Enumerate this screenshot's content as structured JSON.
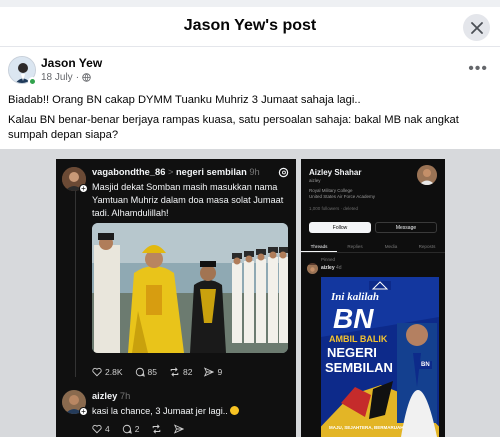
{
  "dialog": {
    "title": "Jason Yew's post"
  },
  "post": {
    "author": "Jason Yew",
    "date": "18 July",
    "dot": "·",
    "more": "•••",
    "paragraphs": [
      "Biadab!! Orang BN cakap DYMM Tuanku Muhriz 3 Jumaat sahaja lagi..",
      "Kalau BN benar-benar berjaya rampas kuasa, satu persoalan sahaja: bakal MB nak angkat sumpah depan siapa?"
    ]
  },
  "threads_post": {
    "username": "vagabondthe_86",
    "separator": ">",
    "community": "negeri sembilan",
    "time": "9h",
    "text": "Masjid dekat Somban masih masukkan nama Yamtuan Muhriz dalam doa masa solat Jumaat tadi. Alhamdulillah!",
    "likes": "2.8K",
    "replies": "85",
    "reposts": "82",
    "shares": "9"
  },
  "threads_reply": {
    "username": "aizley",
    "time": "7h",
    "text": "kasi la chance, 3 Jumaat jer lagi..",
    "likes": "4",
    "replies": "2"
  },
  "profile": {
    "name": "Aizley Shahar",
    "handle": "aizley",
    "bio1": "Royal Military College",
    "bio2": "United States Air Force Academy",
    "followers": "1,000 followers · deleted",
    "follow": "Follow",
    "message": "Message",
    "tabs": [
      "Threads",
      "Replies",
      "Media",
      "Reposts"
    ],
    "pinned": "Pinned",
    "post_user": "aizley",
    "post_time": "4d"
  },
  "poster": {
    "line1": "Ini kalilah",
    "line2": "BN",
    "line3": "AMBIL BALIK",
    "line4": "NEGERI",
    "line5": "SEMBILAN",
    "badge": "BN",
    "tagline": "MAJU, SEJAHTERA, BERMARUAH"
  },
  "colors": {
    "online": "#31a24c",
    "threads_bg": "#101010",
    "royal_yellow": "#e9c41a",
    "poster_blue": "#0d2a8a"
  }
}
